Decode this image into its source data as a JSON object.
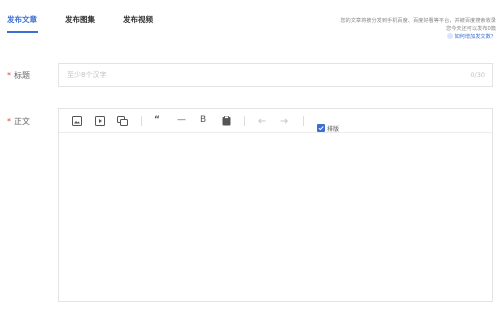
{
  "tabs": [
    {
      "label": "发布文章",
      "active": true
    },
    {
      "label": "发布图集",
      "active": false
    },
    {
      "label": "发布视频",
      "active": false
    }
  ],
  "notice": {
    "line1": "您的文章将被分发到手机百度、百度好看等平台，并被百度搜索收录",
    "line2": "您今天还可以发布0篇",
    "help_link": "如何增加发文数？"
  },
  "title_field": {
    "required_mark": "*",
    "label": "标题",
    "placeholder": "至少8个汉字",
    "value": "",
    "counter": "0/30"
  },
  "body_field": {
    "required_mark": "*",
    "label": "正文"
  },
  "toolbar": {
    "icons": [
      "image-icon",
      "video-icon",
      "gallery-icon",
      "quote-icon",
      "horizontal-rule-icon",
      "bold-icon",
      "clipboard-icon",
      "undo-icon",
      "redo-icon"
    ],
    "quote_glyph": "“",
    "hr_glyph": "—",
    "bold_glyph": "B",
    "typeset_label": "排版"
  },
  "colors": {
    "accent": "#3c6fd1",
    "required": "#e64340",
    "border": "#e3e3e3",
    "muted": "#888888"
  }
}
